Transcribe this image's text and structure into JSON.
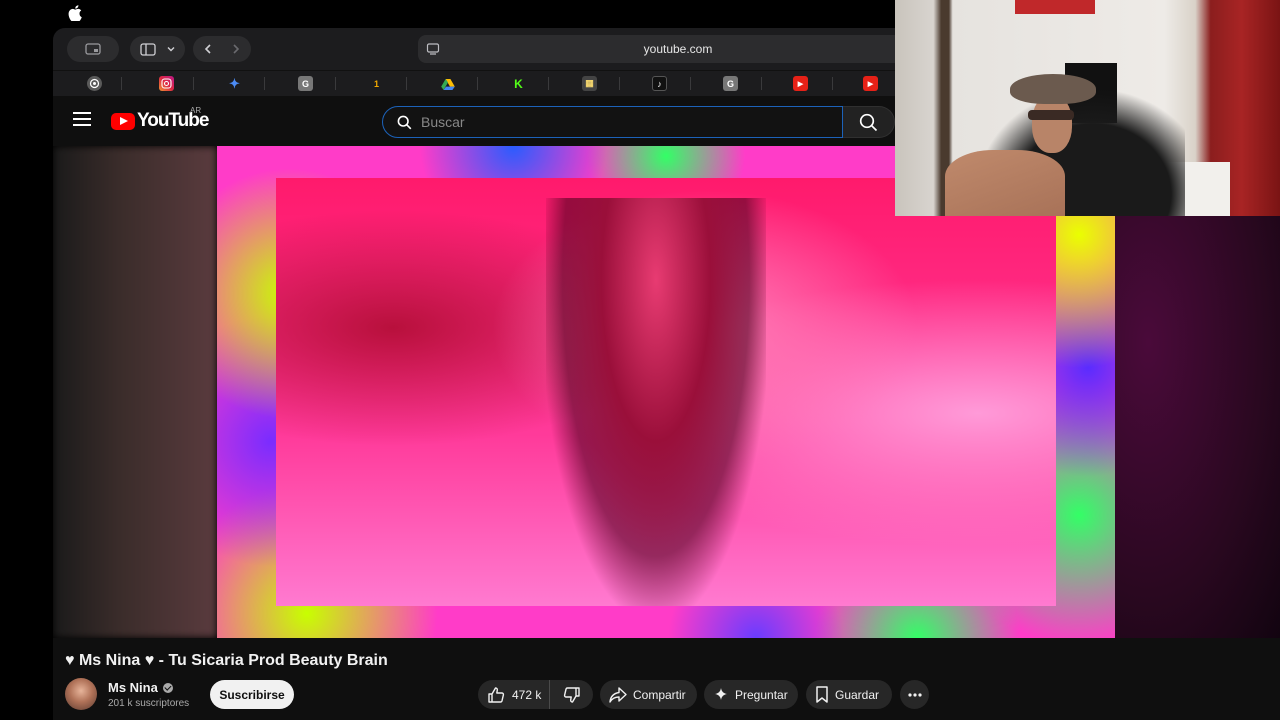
{
  "browser": {
    "url": "youtube.com",
    "favorites": [
      {
        "name": "chatgpt",
        "glyph": "",
        "color": "#5a5a5a"
      },
      {
        "name": "instagram",
        "glyph": "",
        "color": "#c13584"
      },
      {
        "name": "gemini",
        "glyph": "✦",
        "color": "#3b6fe0"
      },
      {
        "name": "google",
        "glyph": "G",
        "color": "#777777"
      },
      {
        "name": "app-1",
        "glyph": "1",
        "color": "#2a2a2a"
      },
      {
        "name": "drive",
        "glyph": "▲",
        "color": "#2a2a2a"
      },
      {
        "name": "kick",
        "glyph": "K",
        "color": "#2a2a2a"
      },
      {
        "name": "app-grid",
        "glyph": "▦",
        "color": "#2a2a2a"
      },
      {
        "name": "tiktok",
        "glyph": "♪",
        "color": "#111111"
      },
      {
        "name": "google-2",
        "glyph": "G",
        "color": "#777777"
      },
      {
        "name": "youtube",
        "glyph": "▶",
        "color": "#e62117"
      },
      {
        "name": "youtube-2",
        "glyph": "▶",
        "color": "#e62117"
      }
    ]
  },
  "youtube": {
    "logo_text": "YouTube",
    "region": "AR",
    "search_placeholder": "Buscar"
  },
  "video": {
    "title": "♥ Ms Nina ♥ - Tu Sicaria Prod Beauty Brain",
    "channel": "Ms Nina",
    "subscribers": "201 k suscriptores",
    "subscribe_label": "Suscribirse",
    "likes": "472 k",
    "share_label": "Compartir",
    "ask_label": "Preguntar",
    "save_label": "Guardar"
  },
  "colors": {
    "brand_red": "#ff0000",
    "search_focus": "#1c62b9",
    "background": "#0f0f0f"
  }
}
